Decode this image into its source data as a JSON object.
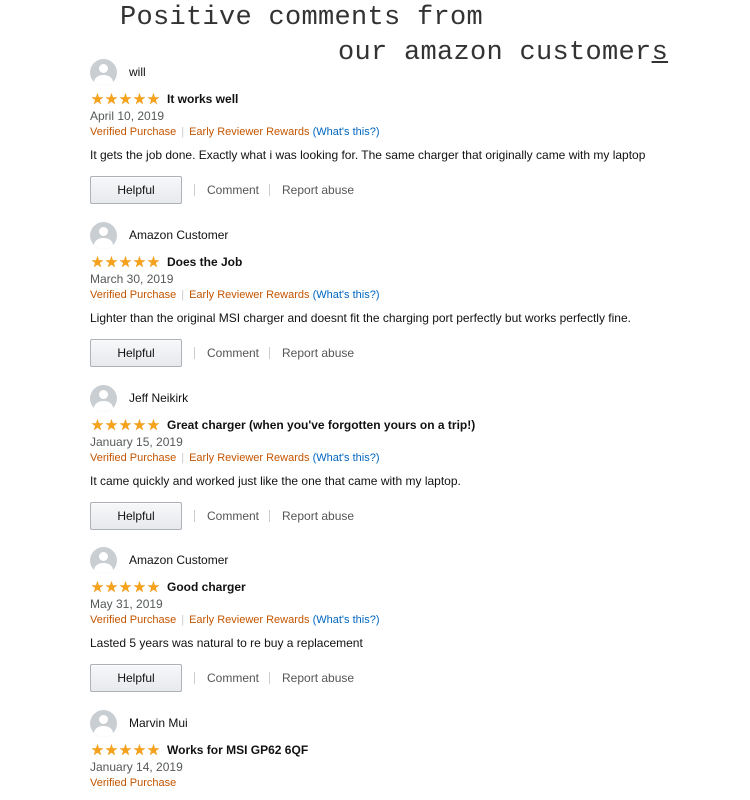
{
  "header": {
    "line1": "Positive comments from",
    "line2_main": "our amazon customer",
    "line2_tail": "s"
  },
  "colors": {
    "star": "#f7a21b",
    "badge_orange": "#c45500",
    "link_blue": "#0066c0"
  },
  "common": {
    "verified": "Verified Purchase",
    "early": "Early Reviewer Rewards",
    "paren_open": "(",
    "whats_this": "What's this?",
    "paren_close": ")",
    "helpful": "Helpful",
    "comment": "Comment",
    "report": "Report abuse"
  },
  "reviews": [
    {
      "name": "will",
      "rating": 5,
      "title": "It works well",
      "date": "April 10, 2019",
      "body": "It gets the job done. Exactly what i was looking for. The same charger that originally came with my laptop"
    },
    {
      "name": "Amazon Customer",
      "rating": 5,
      "title": "Does the Job",
      "date": "March 30, 2019",
      "body": "Lighter than the original MSI charger and doesnt fit the charging port perfectly but works perfectly fine."
    },
    {
      "name": "Jeff Neikirk",
      "rating": 5,
      "title": "Great charger (when you've forgotten yours on a trip!)",
      "date": "January 15, 2019",
      "body": "It came quickly and worked just like the one that came with my laptop."
    },
    {
      "name": "Amazon Customer",
      "rating": 5,
      "title": "Good charger",
      "date": "May 31, 2019",
      "body": "Lasted 5 years was natural to re buy a replacement"
    },
    {
      "name": "Marvin Mui",
      "rating": 5,
      "title": "Works for MSI GP62 6QF",
      "date": "January 14, 2019"
    }
  ]
}
